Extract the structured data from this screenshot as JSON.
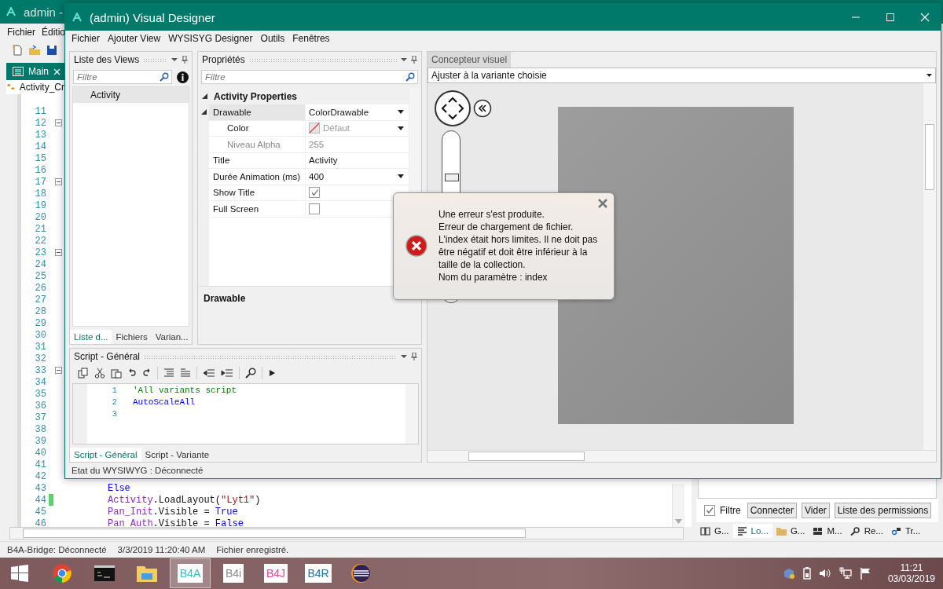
{
  "ide": {
    "title": "admin -",
    "menu": [
      "Fichier",
      "Éditio"
    ],
    "tab": {
      "label": "Main",
      "selected": true
    },
    "module_combo": "Activity_Cr",
    "code_lines": [
      {
        "number": "11",
        "fold": false,
        "changed": false
      },
      {
        "number": "12",
        "fold": true,
        "changed": false
      },
      {
        "number": "13",
        "fold": false,
        "changed": false
      },
      {
        "number": "14",
        "fold": false,
        "changed": false
      },
      {
        "number": "15",
        "fold": false,
        "changed": false
      },
      {
        "number": "16",
        "fold": false,
        "changed": false
      },
      {
        "number": "17",
        "fold": true,
        "changed": false
      },
      {
        "number": "18",
        "fold": false,
        "changed": false
      },
      {
        "number": "19",
        "fold": false,
        "changed": false
      },
      {
        "number": "20",
        "fold": false,
        "changed": false
      },
      {
        "number": "21",
        "fold": false,
        "changed": false
      },
      {
        "number": "22",
        "fold": false,
        "changed": false
      },
      {
        "number": "23",
        "fold": true,
        "changed": false
      },
      {
        "number": "24",
        "fold": false,
        "changed": false
      },
      {
        "number": "25",
        "fold": false,
        "changed": false
      },
      {
        "number": "26",
        "fold": false,
        "changed": false
      },
      {
        "number": "27",
        "fold": false,
        "changed": false
      },
      {
        "number": "28",
        "fold": false,
        "changed": false
      },
      {
        "number": "29",
        "fold": false,
        "changed": false
      },
      {
        "number": "30",
        "fold": false,
        "changed": false
      },
      {
        "number": "31",
        "fold": false,
        "changed": false
      },
      {
        "number": "32",
        "fold": false,
        "changed": false
      },
      {
        "number": "33",
        "fold": true,
        "changed": false
      },
      {
        "number": "34",
        "fold": false,
        "changed": false
      },
      {
        "number": "35",
        "fold": false,
        "changed": false
      },
      {
        "number": "36",
        "fold": false,
        "changed": false
      },
      {
        "number": "37",
        "fold": false,
        "changed": false
      },
      {
        "number": "38",
        "fold": false,
        "changed": false
      },
      {
        "number": "39",
        "fold": false,
        "changed": false
      },
      {
        "number": "40",
        "fold": false,
        "changed": false
      },
      {
        "number": "41",
        "fold": false,
        "changed": false
      },
      {
        "number": "42",
        "fold": false,
        "changed": false
      },
      {
        "number": "43",
        "fold": false,
        "changed": false,
        "tokens": [
          {
            "text": "Else",
            "kind": "keyword"
          }
        ]
      },
      {
        "number": "44",
        "fold": false,
        "changed": true,
        "tokens": [
          {
            "text": "Activity",
            "kind": "object"
          },
          {
            "text": ".LoadLayout(",
            "kind": "plain"
          },
          {
            "text": "\"Lyt1\"",
            "kind": "string"
          },
          {
            "text": ")",
            "kind": "plain"
          }
        ]
      },
      {
        "number": "45",
        "fold": false,
        "changed": false,
        "tokens": [
          {
            "text": "Pan_Init",
            "kind": "object"
          },
          {
            "text": ".Visible = ",
            "kind": "plain"
          },
          {
            "text": "True",
            "kind": "keyword"
          }
        ]
      },
      {
        "number": "46",
        "fold": false,
        "changed": false,
        "tokens": [
          {
            "text": "Pan_Auth",
            "kind": "object"
          },
          {
            "text": ".Visible = ",
            "kind": "plain"
          },
          {
            "text": "False",
            "kind": "keyword"
          }
        ]
      }
    ],
    "logs_panel": {
      "filter": {
        "label": "Filtre",
        "checked": true
      },
      "buttons": [
        "Connecter",
        "Vider",
        "Liste des permissions"
      ],
      "tabs": [
        {
          "label": "G...",
          "selected": false
        },
        {
          "label": "Lo...",
          "selected": true
        },
        {
          "label": "G...",
          "selected": false
        },
        {
          "label": "M...",
          "selected": false
        },
        {
          "label": "Re...",
          "selected": false
        },
        {
          "label": "Tr...",
          "selected": false
        }
      ]
    },
    "status_bar": [
      "B4A-Bridge: Déconnecté",
      "3/3/2019 11:20:40 AM",
      "Fichier enregistré."
    ]
  },
  "designer": {
    "title": "(admin) Visual Designer",
    "menu": [
      "Fichier",
      "Ajouter View",
      "WYSISYG Designer",
      "Outils",
      "Fenêtres"
    ],
    "views_panel": {
      "title": "Liste des Views",
      "placeholder": "Filtre",
      "items": [
        {
          "label": "Activity",
          "selected": true
        }
      ],
      "tabs": [
        {
          "label": "Liste d...",
          "selected": true
        },
        {
          "label": "Fichiers",
          "selected": false
        },
        {
          "label": "Varian...",
          "selected": false
        }
      ]
    },
    "properties": {
      "title": "Propriétés",
      "placeholder": "Filtre",
      "category": "Activity Properties",
      "description": "Drawable",
      "rows": [
        {
          "name": "Drawable",
          "value": "ColorDrawable",
          "kind": "dropdown",
          "selected": true,
          "disabled": false,
          "expanded": true,
          "children": [
            {
              "name": "Color",
              "value": "Défaut",
              "kind": "color",
              "selected": false,
              "disabled": false
            },
            {
              "name": "Niveau Alpha",
              "value": "255",
              "kind": "text",
              "selected": false,
              "disabled": true
            }
          ]
        },
        {
          "name": "Title",
          "value": "Activity",
          "kind": "text",
          "selected": false,
          "disabled": false
        },
        {
          "name": "Durée Animation (ms)",
          "value": "400",
          "kind": "dropdown",
          "selected": false,
          "disabled": false
        },
        {
          "name": "Show Title",
          "kind": "checkbox",
          "checked": true,
          "selected": false,
          "disabled": false
        },
        {
          "name": "Full Screen",
          "kind": "checkbox",
          "checked": false,
          "selected": false,
          "disabled": false
        }
      ]
    },
    "script": {
      "title": "Script - Général",
      "lines": [
        {
          "number": "1",
          "tokens": [
            {
              "text": "'All variants script",
              "kind": "comment"
            }
          ]
        },
        {
          "number": "2",
          "tokens": [
            {
              "text": "AutoScaleAll",
              "kind": "keyword"
            }
          ]
        },
        {
          "number": "3"
        }
      ],
      "tabs": [
        {
          "label": "Script - Général",
          "selected": true
        },
        {
          "label": "Script - Variante",
          "selected": false
        }
      ]
    },
    "visual": {
      "tab": "Concepteur visuel",
      "dropdown": "Ajuster à la variante choisie",
      "zoom_slider": {
        "level": 0.75
      }
    },
    "status": "Etat du WYSIWYG : Déconnecté"
  },
  "error_dialog": {
    "messages": [
      "Une erreur s'est produite.",
      "Erreur de chargement de fichier.",
      "L'index était hors limites. Il ne doit pas être négatif et doit être inférieur à la taille de la collection.",
      "Nom du paramètre : index"
    ]
  },
  "taskbar": {
    "apps": [
      {
        "kind": "windows",
        "selected": false
      },
      {
        "kind": "chrome",
        "selected": false
      },
      {
        "kind": "terminal",
        "selected": false
      },
      {
        "kind": "folder",
        "selected": false
      },
      {
        "kind": "b4",
        "label": "B4A",
        "color": "#2cc6c6",
        "selected": true
      },
      {
        "kind": "b4",
        "label": "B4i",
        "color": "#8a8a8a",
        "selected": false
      },
      {
        "kind": "b4",
        "label": "B4J",
        "color": "#e0459a",
        "selected": false
      },
      {
        "kind": "b4",
        "label": "B4R",
        "color": "#1f6fa8",
        "selected": false
      },
      {
        "kind": "eclipse",
        "selected": false
      }
    ],
    "time": "11:21",
    "date": "03/03/2019"
  }
}
